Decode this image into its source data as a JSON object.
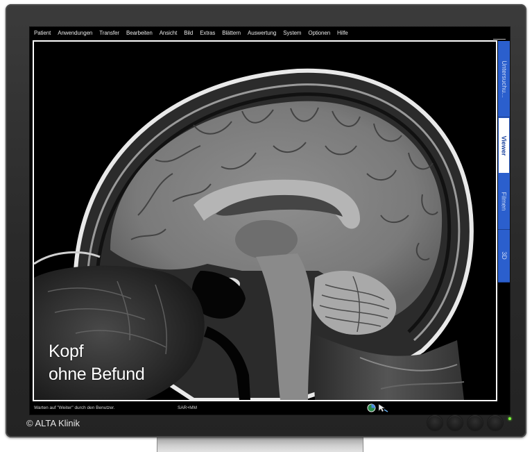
{
  "menubar": {
    "items": [
      {
        "id": "patient",
        "label": "Patient"
      },
      {
        "id": "anwendungen",
        "label": "Anwendungen"
      },
      {
        "id": "transfer",
        "label": "Transfer"
      },
      {
        "id": "bearbeiten",
        "label": "Bearbeiten"
      },
      {
        "id": "ansicht",
        "label": "Ansicht"
      },
      {
        "id": "bild",
        "label": "Bild"
      },
      {
        "id": "extras",
        "label": "Extras"
      },
      {
        "id": "blaettern",
        "label": "Blättern"
      },
      {
        "id": "auswertung",
        "label": "Auswertung"
      },
      {
        "id": "system",
        "label": "System"
      },
      {
        "id": "optionen",
        "label": "Optionen"
      },
      {
        "id": "hilfe",
        "label": "Hilfe"
      }
    ]
  },
  "side_tabs": [
    {
      "id": "untersuchung",
      "label": "Untersuchu...",
      "active": false
    },
    {
      "id": "viewer",
      "label": "Viewer",
      "active": true
    },
    {
      "id": "filmen",
      "label": "Filmen",
      "active": false
    },
    {
      "id": "3d",
      "label": "3D",
      "active": false
    }
  ],
  "caption": {
    "line1": "Kopf",
    "line2": "ohne Befund"
  },
  "statusbar": {
    "message": "Warten auf \"Weiter\" durch den Benutzer.",
    "user": "SAR+MM"
  },
  "bezel": {
    "copyright": "© ALTA Klinik"
  },
  "colors": {
    "tab_blue": "#2b5fcd",
    "led_green": "#7dff3c",
    "bezel": "#2a2a2a"
  }
}
